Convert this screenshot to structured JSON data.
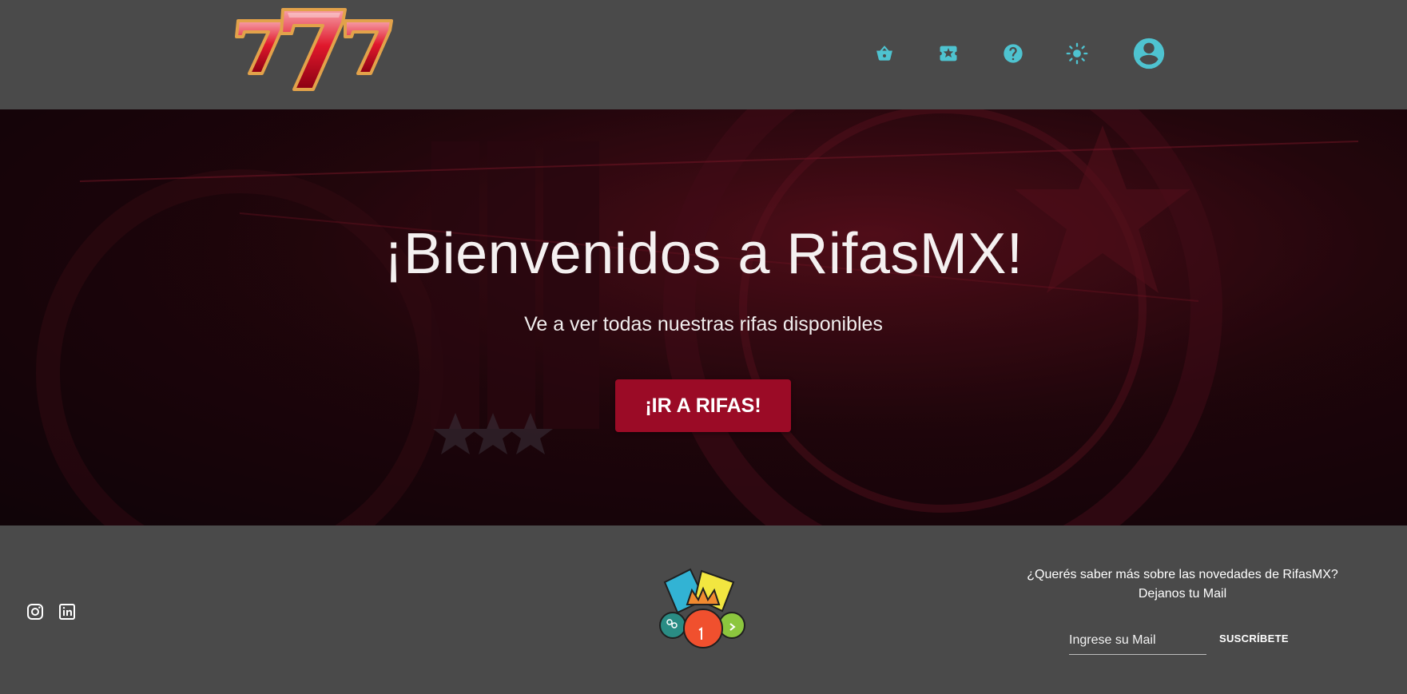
{
  "header": {
    "logo_icon": "lucky-777-logo",
    "nav": [
      {
        "icon": "basket-icon"
      },
      {
        "icon": "ticket-icon"
      },
      {
        "icon": "help-icon"
      },
      {
        "icon": "brightness-icon"
      }
    ],
    "avatar_icon": "account-circle-icon",
    "accent_color": "#4ec3d0"
  },
  "hero": {
    "title": "¡Bienvenidos a RifasMX!",
    "subtitle": "Ve a ver todas nuestras rifas disponibles",
    "button_label": "¡IR A RIFAS!",
    "button_color": "#9b0b26"
  },
  "footer": {
    "social": [
      {
        "icon": "instagram-icon"
      },
      {
        "icon": "linkedin-icon"
      }
    ],
    "logo_icon": "lottery-balls-logo",
    "newsletter": {
      "question": "¿Querés saber más sobre las novedades de RifasMX?",
      "cta": "Dejanos tu Mail",
      "placeholder": "Ingrese su Mail",
      "button_label": "SUSCRÍBETE"
    }
  },
  "colors": {
    "background": "#4a4a4a",
    "accent": "#4ec3d0",
    "brand_red": "#9b0b26"
  }
}
